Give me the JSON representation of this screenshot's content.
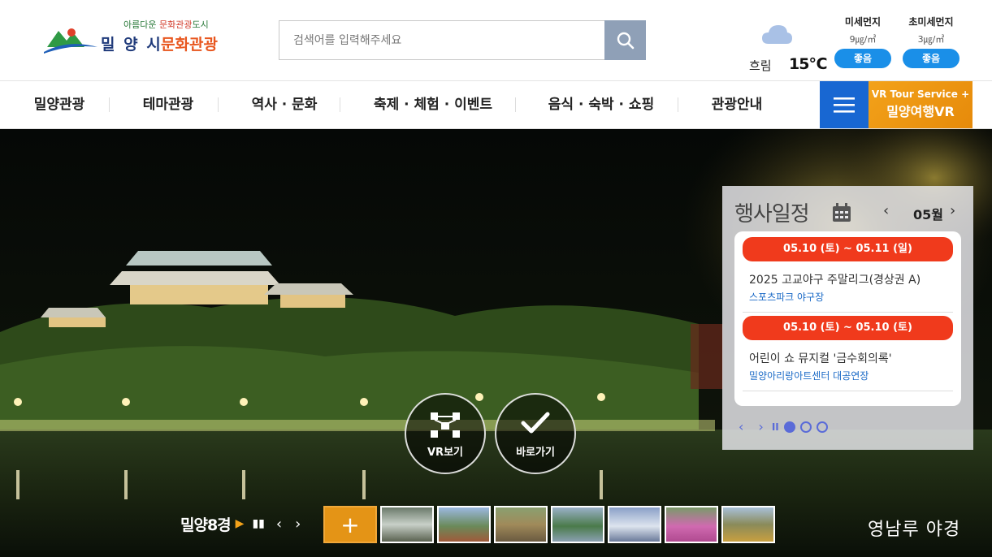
{
  "header": {
    "logo": {
      "slogan_prefix": "아름다운",
      "slogan_highlight": "문화관광",
      "slogan_suffix": "도시",
      "name_city": "밀 양 시",
      "name_suffix": "문화관광"
    },
    "search": {
      "placeholder": "검색어를 입력해주세요",
      "icon": "search-icon"
    },
    "weather": {
      "condition": "흐림",
      "temperature": "15℃",
      "icon": "cloud-icon"
    },
    "dust": [
      {
        "label": "미세먼지",
        "value": "9㎍/㎥",
        "status": "좋음"
      },
      {
        "label": "초미세먼지",
        "value": "3㎍/㎥",
        "status": "좋음"
      }
    ]
  },
  "nav": {
    "items": [
      "밀양관광",
      "테마관광",
      "역사 · 문화",
      "축제 · 체험 · 이벤트",
      "음식 · 숙박 · 쇼핑",
      "관광안내"
    ],
    "menu_icon": "hamburger-icon",
    "vr": {
      "line1": "VR Tour Service +",
      "line2": "밀양여행VR"
    }
  },
  "hero": {
    "buttons": [
      {
        "label": "VR보기",
        "icon": "vr-network-icon"
      },
      {
        "label": "바로가기",
        "icon": "check-icon"
      }
    ],
    "events": {
      "title": "행사일정",
      "month": "05월",
      "items": [
        {
          "date": "05.10 (토) ~ 05.11 (일)",
          "name": "2025 고교야구 주말리그(경상권 A)",
          "place": "스포츠파크 야구장"
        },
        {
          "date": "05.10 (토) ~ 05.10 (토)",
          "name": "어린이 쇼 뮤지컬 '금수회의록'",
          "place": "밀양아리랑아트센터 대공연장"
        }
      ]
    },
    "strip": {
      "label": "밀양8경",
      "plus": "+"
    },
    "caption": "영남루 야경"
  },
  "colors": {
    "accent_blue": "#1867d2",
    "badge_blue": "#1a8fe8",
    "event_red": "#f03a1c",
    "vr_orange": "#f3a21a"
  }
}
